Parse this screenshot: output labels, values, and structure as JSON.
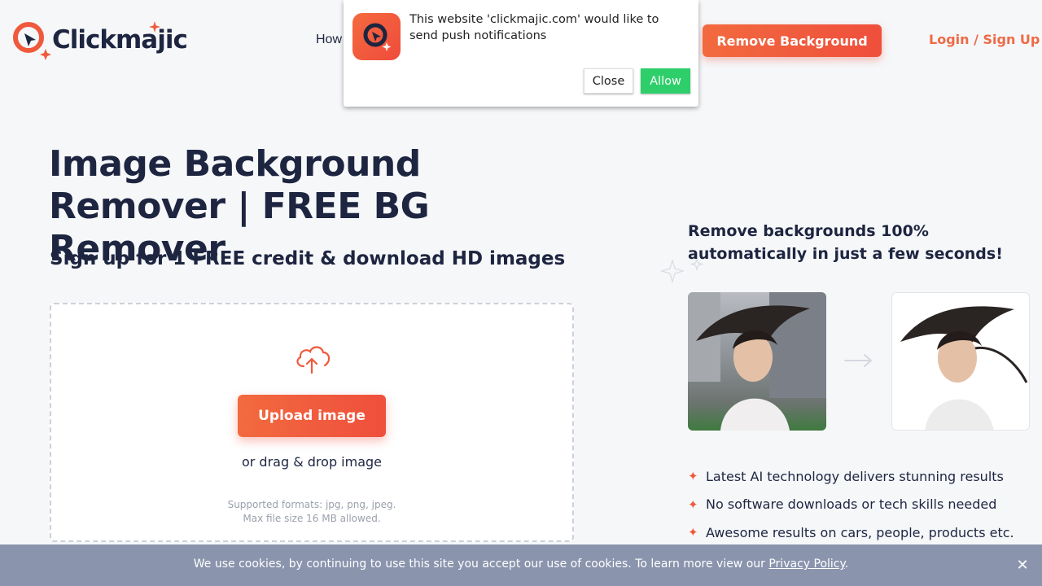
{
  "header": {
    "logo_text": "Clickmajic",
    "nav_how": "How",
    "remove_bg_button": "Remove Background",
    "login_link": "Login / Sign Up"
  },
  "push_popup": {
    "message": "This website 'clickmajic.com' would like to send push notifications",
    "close_label": "Close",
    "allow_label": "Allow"
  },
  "hero": {
    "title": "Image Background Remover | FREE BG Remover",
    "subtitle": "Sign up for 1 FREE credit & download HD images"
  },
  "upload": {
    "button_label": "Upload image",
    "drag_text": "or drag & drop image",
    "formats_line1": "Supported formats: jpg, png, jpeg.",
    "formats_line2": "Max file size 16 MB allowed."
  },
  "right": {
    "title": "Remove backgrounds 100% automatically in just a few seconds!",
    "features": [
      "Latest AI technology delivers stunning results",
      "No software downloads or tech skills needed",
      "Awesome results on cars, people, products etc."
    ]
  },
  "cookie": {
    "text": "We use cookies, by continuing to use this site you accept our use of cookies. To learn more view our",
    "link": "Privacy Policy",
    "suffix": "."
  },
  "colors": {
    "brand_orange": "#ef5a3d",
    "navy": "#1d2540",
    "allow_green": "#2ecf6a",
    "cookie_bar": "#8a94ad"
  }
}
